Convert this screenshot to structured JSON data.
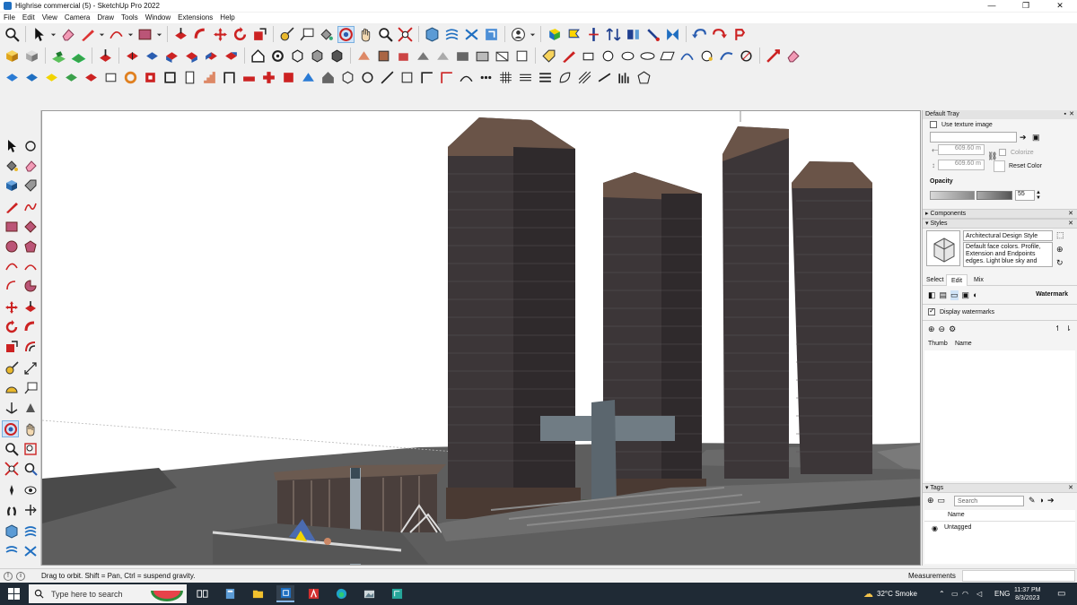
{
  "window": {
    "title": "Highrise commercial (5) - SketchUp Pro 2022",
    "minimize": "—",
    "maximize": "❐",
    "close": "✕"
  },
  "menu": [
    "File",
    "Edit",
    "View",
    "Camera",
    "Draw",
    "Tools",
    "Window",
    "Extensions",
    "Help"
  ],
  "tray": {
    "title": "Default Tray",
    "use_texture_label": "Use texture image",
    "width_value": "609.60 m",
    "height_value": "609.60 m",
    "colorize_label": "Colorize",
    "reset_color_label": "Reset Color",
    "opacity_label": "Opacity",
    "opacity_value": "55",
    "components_label": "Components",
    "styles_label": "Styles",
    "style_name": "Architectural Design Style",
    "style_description": "Default face colors. Profile, Extension and Endpoints edges. Light blue sky and gray",
    "tabs": [
      "Select",
      "Edit",
      "Mix"
    ],
    "active_tab": "Edit",
    "watermark_label": "Watermark",
    "display_watermarks_label": "Display watermarks",
    "col_thumb": "Thumb",
    "col_name": "Name",
    "tags_label": "Tags",
    "tags_search_placeholder": "Search",
    "tags_name_header": "Name",
    "tag_untagged": "Untagged"
  },
  "status": {
    "message": "Drag to orbit. Shift = Pan, Ctrl = suspend gravity.",
    "measurements_label": "Measurements"
  },
  "taskbar": {
    "search_placeholder": "Type here to search",
    "weather": "32°C  Smoke",
    "language": "ENG",
    "time": "11:37 PM",
    "date": "8/3/2023"
  },
  "colors": {
    "viewport_bg": "#ffffff",
    "building": "#3a3638",
    "ground": "#5e5e5e",
    "accent": "#1f6fc1"
  }
}
